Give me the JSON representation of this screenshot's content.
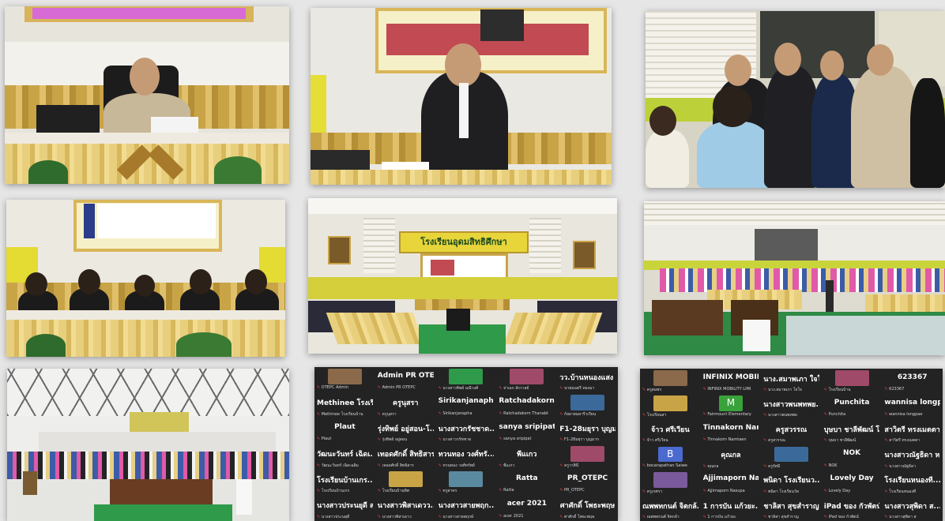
{
  "photo1": {
    "alt": "Speaker at head table",
    "type": "photo"
  },
  "photo2": {
    "alt": "Speaker at podium",
    "type": "photo"
  },
  "photo3": {
    "alt": "Group conversation",
    "type": "photo"
  },
  "photo4": {
    "alt": "Panel of five seated",
    "type": "photo"
  },
  "photo5": {
    "alt": "Hall with banner",
    "banner_text": "โรงเรียนอุดมสิทธิศึกษา",
    "type": "photo"
  },
  "photo6": {
    "alt": "Large hall audience",
    "type": "photo"
  },
  "photo7": {
    "alt": "Group photo in gym",
    "type": "photo"
  },
  "zoom1": {
    "cells": [
      {
        "name": "",
        "sub": "OTEPC Admin"
      },
      {
        "name": "Admin PR OTEPC",
        "sub": "Admin PR OTEPC"
      },
      {
        "name": "",
        "sub": "นางสาวทิพย์ มณีวงศ์"
      },
      {
        "name": "",
        "sub": "จ่าเอก สังวาลย์"
      },
      {
        "name": "วว.บ้านหนองแสง ส...",
        "sub": "นายมนตรี ทองมา"
      },
      {
        "name": "Methinee โรงเรี...",
        "sub": "Methinee โรงเรียนบ้าน"
      },
      {
        "name": "ครูนุสรา",
        "sub": "ครูนุสรา"
      },
      {
        "name": "Sirikanjanapha",
        "sub": "Sirikanjanapha"
      },
      {
        "name": "Ratchadakorn T...",
        "sub": "Ratchadakorn Thanabt"
      },
      {
        "name": "",
        "sub": "กัลยาสมยารีวเรียน"
      },
      {
        "name": "Plaut",
        "sub": "Plaut"
      },
      {
        "name": "รุ่งทิพย์ อยู่สอน-โ...",
        "sub": "รุ่งทิพย์ อยู่สอน"
      },
      {
        "name": "นางสาวกรัชชาด...",
        "sub": "นางสาวกรัชชาด"
      },
      {
        "name": "sanya sripipat",
        "sub": "sanya sripipat"
      },
      {
        "name": "F1-28มยุรา บุญมาก",
        "sub": "F1-28มยุรา บุญมาก"
      },
      {
        "name": "วัฒนะวันทร์ เฉิดเ...",
        "sub": "วัฒนะวันทร์ เฉิดเฉลิม"
      },
      {
        "name": "เทอดศักดิ์ สิทธิสาร",
        "sub": "เทอดศักดิ์ สิทธิสาร"
      },
      {
        "name": "ทวนทอง วงศ์ทรั...",
        "sub": "ทวนทอง วงศ์ทรัพย์"
      },
      {
        "name": "พีแเกว",
        "sub": "พีแเกว"
      },
      {
        "name": "",
        "sub": "ครูวาสินี"
      },
      {
        "name": "โรงเรียนบ้านเกร...",
        "sub": "โรงเรียนบ้านเกร"
      },
      {
        "name": "",
        "sub": "โรงเรียนบ้านทิศ"
      },
      {
        "name": "",
        "sub": "ครูสาคร"
      },
      {
        "name": "Ratta",
        "sub": "Ratta"
      },
      {
        "name": "PR_OTEPC",
        "sub": "PR_OTEPC"
      },
      {
        "name": "นางสาวประนยุดี ส...",
        "sub": "นางสาวประนยุดี"
      },
      {
        "name": "นางสาวพิสาเดวว...",
        "sub": "นางสาวพิสาเดวว"
      },
      {
        "name": "นางสาวสายพฤก...",
        "sub": "นางสาวสายพฤกษ์"
      },
      {
        "name": "acer 2021",
        "sub": "acer 2021"
      },
      {
        "name": "ศาศักดิ์ โพธะพฤษ",
        "sub": "ศาศักดิ์ โพธะพฤษ"
      }
    ]
  },
  "zoom2": {
    "cells": [
      {
        "name": "",
        "sub": "ครูสมพร"
      },
      {
        "name": "INFINIX MOBILI...",
        "sub": "INFINIX MOBILITY LIMI"
      },
      {
        "name": "นาง.สมาพเภา ใจใ...",
        "sub": "นาง.สมาพเภา ใจใจ"
      },
      {
        "name": "",
        "sub": "โรงเรียนบ้าน"
      },
      {
        "name": "623367",
        "sub": "623367"
      },
      {
        "name": "",
        "sub": "โรงเรียนสา"
      },
      {
        "name": "M",
        "sub": "Fairmount Elementary"
      },
      {
        "name": "นางสาวพนพทพย...",
        "sub": "นางสาวพนพทพย"
      },
      {
        "name": "Punchita",
        "sub": "Punchita"
      },
      {
        "name": "wannisa longpae",
        "sub": "wannisa longpae"
      },
      {
        "name": "จ้าว ศรีเวียน",
        "sub": "จ้าว ศรีเวียน"
      },
      {
        "name": "Tinnakorn Nam...",
        "sub": "Tinnakorn Namtaen"
      },
      {
        "name": "ครูสวรรณ",
        "sub": "ครูสวรรณ"
      },
      {
        "name": "บุษบา ชาลีพัฒน์ โ...",
        "sub": "บุษบา ชาลีพัฒน์"
      },
      {
        "name": "สาวิตรี ทรงเมตตา...",
        "sub": "สาวิตรี ทรงเมตตา"
      },
      {
        "name": "B",
        "sub": "bocarapathan Saiwe"
      },
      {
        "name": "คุณกล",
        "sub": "คุณกล"
      },
      {
        "name": "",
        "sub": "ครูรัศมี"
      },
      {
        "name": "NOK",
        "sub": "NOK"
      },
      {
        "name": "นางสาวณัฐธิดา ห...",
        "sub": "นางสาวณัฐธิดา"
      },
      {
        "name": "",
        "sub": "ครูเกศรา"
      },
      {
        "name": "Ajjimaporn Nas...",
        "sub": "Ajjimaporn Nasupa"
      },
      {
        "name": "พนิดา โรงเรียนว...",
        "sub": "พนิดา โรงเรียนวัด"
      },
      {
        "name": "Lovely Day",
        "sub": "Lovely Day"
      },
      {
        "name": "โรงเรียนหนองที...",
        "sub": "โรงเรียนหนองที"
      },
      {
        "name": "ณพพทกนต์ จิตกล้...",
        "sub": "ณพพทกนต์ จิตกล้า"
      },
      {
        "name": "1 การบัน แก้วยะ...",
        "sub": "1 การบัน แก้วยะ"
      },
      {
        "name": "ชาลิสา สุขสำราญ",
        "sub": "ชาลิสา สุขสำราญ"
      },
      {
        "name": "iPad ของ กัวพัตน์",
        "sub": "iPad ของ กัวพัตน์"
      },
      {
        "name": "นางสาวสุพิดา ส...",
        "sub": "นางสาวสุพิดา ส"
      }
    ]
  }
}
